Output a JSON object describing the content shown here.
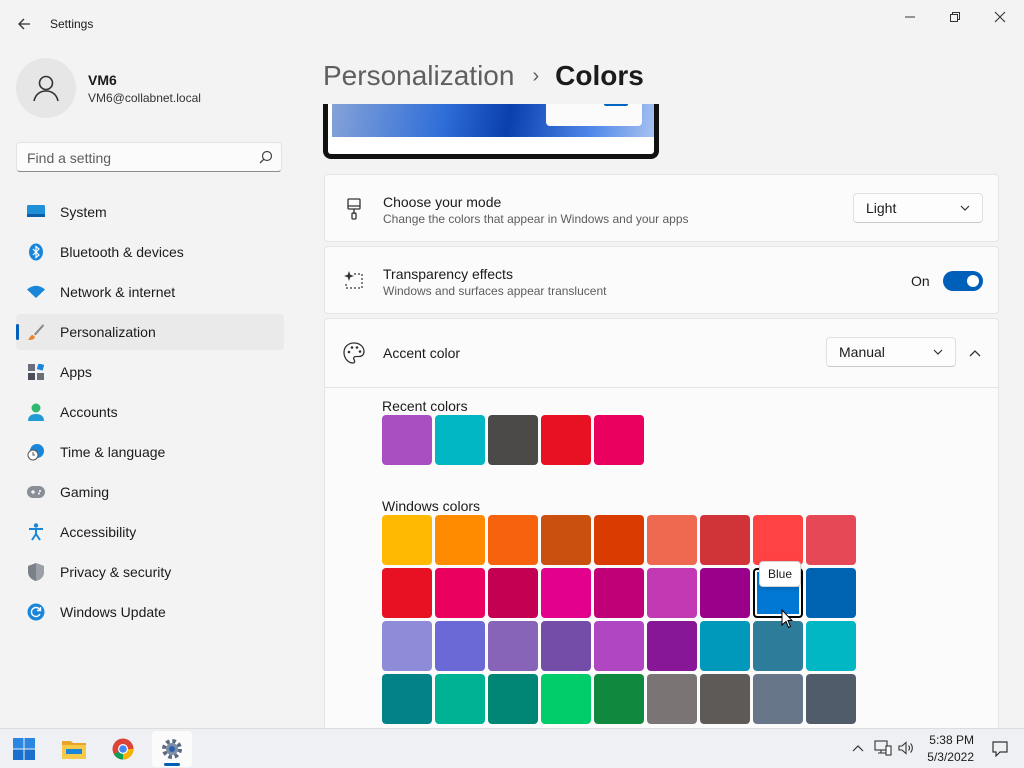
{
  "window": {
    "title": "Settings"
  },
  "user": {
    "name": "VM6",
    "email": "VM6@collabnet.local"
  },
  "search": {
    "placeholder": "Find a setting"
  },
  "nav": {
    "items": [
      {
        "label": "System",
        "icon": "monitor-icon"
      },
      {
        "label": "Bluetooth & devices",
        "icon": "bluetooth-icon"
      },
      {
        "label": "Network & internet",
        "icon": "wifi-icon"
      },
      {
        "label": "Personalization",
        "icon": "brush-icon",
        "active": true
      },
      {
        "label": "Apps",
        "icon": "apps-icon"
      },
      {
        "label": "Accounts",
        "icon": "person-icon"
      },
      {
        "label": "Time & language",
        "icon": "clock-globe-icon"
      },
      {
        "label": "Gaming",
        "icon": "gamepad-icon"
      },
      {
        "label": "Accessibility",
        "icon": "accessibility-icon"
      },
      {
        "label": "Privacy & security",
        "icon": "shield-icon"
      },
      {
        "label": "Windows Update",
        "icon": "update-icon"
      }
    ]
  },
  "header": {
    "parent": "Personalization",
    "separator": "›",
    "current": "Colors"
  },
  "mode": {
    "title": "Choose your mode",
    "subtitle": "Change the colors that appear in Windows and your apps",
    "value": "Light"
  },
  "transparency": {
    "title": "Transparency effects",
    "subtitle": "Windows and surfaces appear translucent",
    "state_label": "On",
    "on": true
  },
  "accent": {
    "title": "Accent color",
    "value": "Manual",
    "recent_label": "Recent colors",
    "recent": [
      "#a94fc1",
      "#00b7c3",
      "#4c4a48",
      "#e81123",
      "#ea005e"
    ],
    "windows_label": "Windows colors",
    "windows_colors": [
      [
        "#ffb900",
        "#ff8c00",
        "#f7630c",
        "#ca5010",
        "#da3b01",
        "#ef6950",
        "#d13438",
        "#ff4343",
        "#e74856"
      ],
      [
        "#e81123",
        "#ea005e",
        "#c30052",
        "#e3008c",
        "#bf0077",
        "#c239b3",
        "#9a0089",
        "#0078d4",
        "#0063b1"
      ],
      [
        "#8e8cd8",
        "#6b69d6",
        "#8764b8",
        "#744da9",
        "#b146c2",
        "#881798",
        "#0099bc",
        "#2d7d9a",
        "#00b7c3"
      ],
      [
        "#038387",
        "#00b294",
        "#018574",
        "#00cc6a",
        "#10893e",
        "#7a7574",
        "#5d5a58",
        "#68768a",
        "#515c6b"
      ]
    ],
    "selected_row": 1,
    "selected_col": 7,
    "tooltip": "Blue"
  },
  "taskbar": {
    "apps": [
      "start-icon",
      "file-explorer-icon",
      "chrome-icon",
      "settings-icon"
    ],
    "time": "5:38 PM",
    "date": "5/3/2022"
  }
}
